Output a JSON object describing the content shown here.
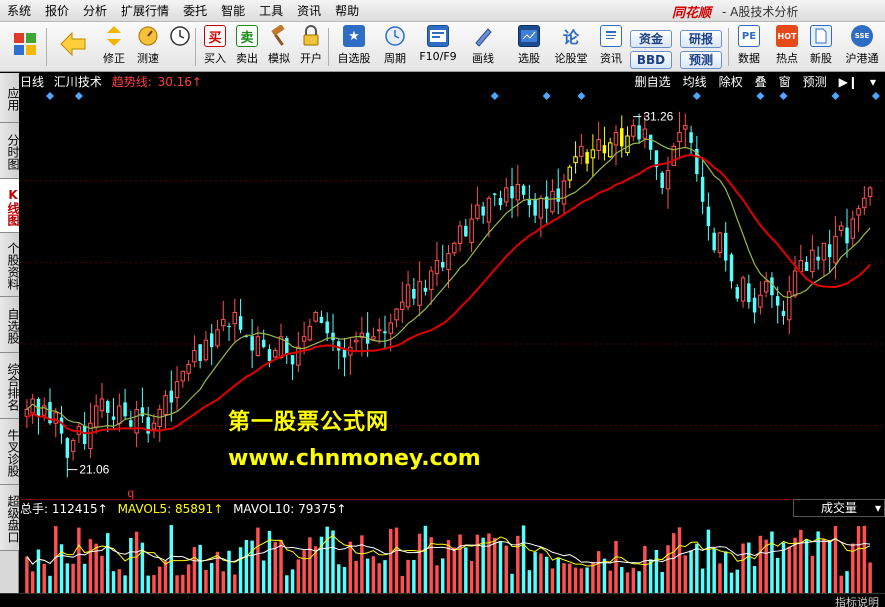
{
  "menubar": {
    "items": [
      "系统",
      "报价",
      "分析",
      "扩展行情",
      "委托",
      "智能",
      "工具",
      "资讯",
      "帮助"
    ],
    "brand": "同花顺",
    "window_title": "- A股技术分析"
  },
  "toolbar": {
    "buttons": [
      {
        "label": "",
        "icon": "grid-icon"
      },
      {
        "label": "",
        "icon": "back-arrow-icon"
      },
      {
        "label": "修正",
        "icon": "updown-arrow-icon"
      },
      {
        "label": "测速",
        "icon": "speedometer-icon"
      },
      {
        "label": "买入",
        "icon": "buy-icon",
        "glyph": "买"
      },
      {
        "label": "卖出",
        "icon": "sell-icon",
        "glyph": "卖"
      },
      {
        "label": "模拟",
        "icon": "hammer-icon"
      },
      {
        "label": "开户",
        "icon": "lock-icon"
      },
      {
        "label": "自选股",
        "icon": "star-folder-icon"
      },
      {
        "label": "周期",
        "icon": "clock-icon"
      },
      {
        "label": "F10/F9",
        "icon": "f10-icon"
      },
      {
        "label": "画线",
        "icon": "pen-icon"
      },
      {
        "label": "选股",
        "icon": "screen-icon"
      },
      {
        "label": "论股堂",
        "icon": "discuss-icon",
        "glyph": "论"
      },
      {
        "label": "资讯",
        "icon": "news-icon"
      },
      {
        "label": "数据",
        "icon": "pe-icon",
        "glyph": "PE"
      },
      {
        "label": "热点",
        "icon": "hot-icon",
        "glyph": "HOT"
      },
      {
        "label": "新股",
        "icon": "new-stock-icon"
      },
      {
        "label": "沪港通",
        "icon": "hk-connect-icon",
        "glyph": "SSE"
      }
    ],
    "pills": [
      "资金",
      "研报",
      "BBD",
      "预测"
    ]
  },
  "sidetabs": [
    "应用",
    "分时图",
    "K线图",
    "个股资料",
    "自选股",
    "综合排名",
    "牛叉诊股",
    "超级盘口"
  ],
  "chart_header": {
    "period": "日线",
    "indicator": "汇川技术",
    "trend_label": "趋势线:",
    "trend_value": "30.16↑",
    "tools": [
      "删自选",
      "均线",
      "除权",
      "叠",
      "窗",
      "预测"
    ]
  },
  "chart_labels": {
    "high_label": "31.26",
    "low_label": "21.06",
    "q_marker": "q"
  },
  "volume_header": {
    "total_label": "总手:",
    "total_value": "112415↑",
    "ma5_label": "MAVOL5:",
    "ma5_value": "85891↑",
    "ma10_label": "MAVOL10:",
    "ma10_value": "79375↑",
    "select": "成交量"
  },
  "watermark": {
    "line1": "第一股票公式网",
    "line2": "www.chnmoney.com"
  },
  "status": {
    "indicator_text": "指标说明"
  },
  "colors": {
    "up": "#ff5050",
    "down": "#54ffff",
    "trend": "#e00000",
    "ma": "#9ab84a",
    "highlight": "#ffff00"
  },
  "chart_data": {
    "type": "candlestick",
    "title": "汇川技术",
    "ylim": [
      20.5,
      32.0
    ],
    "high": 31.26,
    "low": 21.06,
    "trend_value": 30.16,
    "closes": [
      22.8,
      23.1,
      22.6,
      22.9,
      22.4,
      22.7,
      22.1,
      21.4,
      21.9,
      22.3,
      21.8,
      22.4,
      22.9,
      23.1,
      22.7,
      22.5,
      22.9,
      22.6,
      22.3,
      22.8,
      22.6,
      22.1,
      22.4,
      22.8,
      23.2,
      23.0,
      23.6,
      23.9,
      24.1,
      24.5,
      24.2,
      24.8,
      24.6,
      25.1,
      25.4,
      25.2,
      25.6,
      25.1,
      24.9,
      24.5,
      24.9,
      24.6,
      24.2,
      24.5,
      24.9,
      24.4,
      24.1,
      24.6,
      24.9,
      25.2,
      25.6,
      25.3,
      25.0,
      24.8,
      24.5,
      24.3,
      24.6,
      24.8,
      25.0,
      24.7,
      24.9,
      25.1,
      25.0,
      25.3,
      25.7,
      25.9,
      26.4,
      26.0,
      26.5,
      26.2,
      26.8,
      27.1,
      26.9,
      27.3,
      27.6,
      28.1,
      27.8,
      28.3,
      28.7,
      28.4,
      28.9,
      29.0,
      28.7,
      29.2,
      28.9,
      29.3,
      29.0,
      28.7,
      28.4,
      28.9,
      28.6,
      29.1,
      28.8,
      29.4,
      29.8,
      30.1,
      30.4,
      29.9,
      30.3,
      30.6,
      30.2,
      30.5,
      30.8,
      30.4,
      30.7,
      31.0,
      30.6,
      30.9,
      30.3,
      29.8,
      29.2,
      29.7,
      30.4,
      30.8,
      31.0,
      30.5,
      29.6,
      28.8,
      28.1,
      27.4,
      27.9,
      27.1,
      26.5,
      26.0,
      26.6,
      25.9,
      25.6,
      26.1,
      26.5,
      26.1,
      25.8,
      25.5,
      26.2,
      26.8,
      27.1,
      26.8,
      27.4,
      27.1,
      27.6,
      27.2,
      27.8,
      28.1,
      27.6,
      28.3,
      28.6,
      28.9,
      29.2
    ]
  }
}
